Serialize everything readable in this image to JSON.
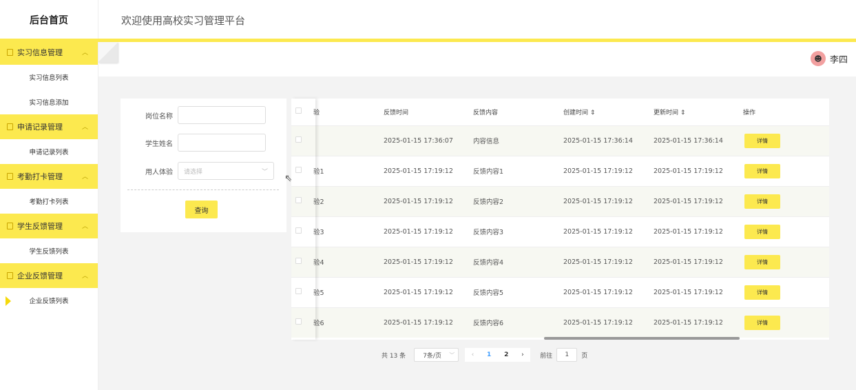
{
  "sidebar": {
    "brand": "后台首页",
    "groups": [
      {
        "title": "实习信息管理",
        "items": [
          "实习信息列表",
          "实习信息添加"
        ]
      },
      {
        "title": "申请记录管理",
        "items": [
          "申请记录列表"
        ]
      },
      {
        "title": "考勤打卡管理",
        "items": [
          "考勤打卡列表"
        ]
      },
      {
        "title": "学生反馈管理",
        "items": [
          "学生反馈列表"
        ]
      },
      {
        "title": "企业反馈管理",
        "items": [
          "企业反馈列表"
        ]
      }
    ],
    "active_item": "企业反馈列表"
  },
  "header": {
    "title": "欢迎使用高校实习管理平台"
  },
  "user": {
    "name": "李四"
  },
  "search": {
    "fields": [
      {
        "label": "岗位名称",
        "value": ""
      },
      {
        "label": "学生姓名",
        "value": ""
      },
      {
        "label": "用人体验",
        "placeholder": "请选择"
      }
    ],
    "query_label": "查询"
  },
  "table": {
    "headers": [
      "验",
      "反馈时间",
      "反馈内容",
      "创建时间 ⇕",
      "更新时间 ⇕",
      "操作"
    ],
    "rows": [
      [
        "",
        "2025-01-15 17:36:07",
        "内容信息",
        "2025-01-15 17:36:14",
        "2025-01-15 17:36:14"
      ],
      [
        "验1",
        "2025-01-15 17:19:12",
        "反馈内容1",
        "2025-01-15 17:19:12",
        "2025-01-15 17:19:12"
      ],
      [
        "验2",
        "2025-01-15 17:19:12",
        "反馈内容2",
        "2025-01-15 17:19:12",
        "2025-01-15 17:19:12"
      ],
      [
        "验3",
        "2025-01-15 17:19:12",
        "反馈内容3",
        "2025-01-15 17:19:12",
        "2025-01-15 17:19:12"
      ],
      [
        "验4",
        "2025-01-15 17:19:12",
        "反馈内容4",
        "2025-01-15 17:19:12",
        "2025-01-15 17:19:12"
      ],
      [
        "验5",
        "2025-01-15 17:19:12",
        "反馈内容5",
        "2025-01-15 17:19:12",
        "2025-01-15 17:19:12"
      ],
      [
        "验6",
        "2025-01-15 17:19:12",
        "反馈内容6",
        "2025-01-15 17:19:12",
        "2025-01-15 17:19:12"
      ]
    ],
    "detail_label": "详情"
  },
  "pager": {
    "total": "共 13 条",
    "page_size": "7条/页",
    "pages": [
      "1",
      "2"
    ],
    "current": "1",
    "goto_prefix": "前往",
    "goto_value": "1",
    "goto_suffix": "页"
  },
  "colors": {
    "accent": "#fce94f",
    "link": "#409eff"
  },
  "icons": [
    "doc-icon",
    "chevron-up-icon",
    "avatar-icon",
    "chevron-down-icon",
    "arrow-left-icon",
    "arrow-right-icon",
    "cursor-icon"
  ]
}
